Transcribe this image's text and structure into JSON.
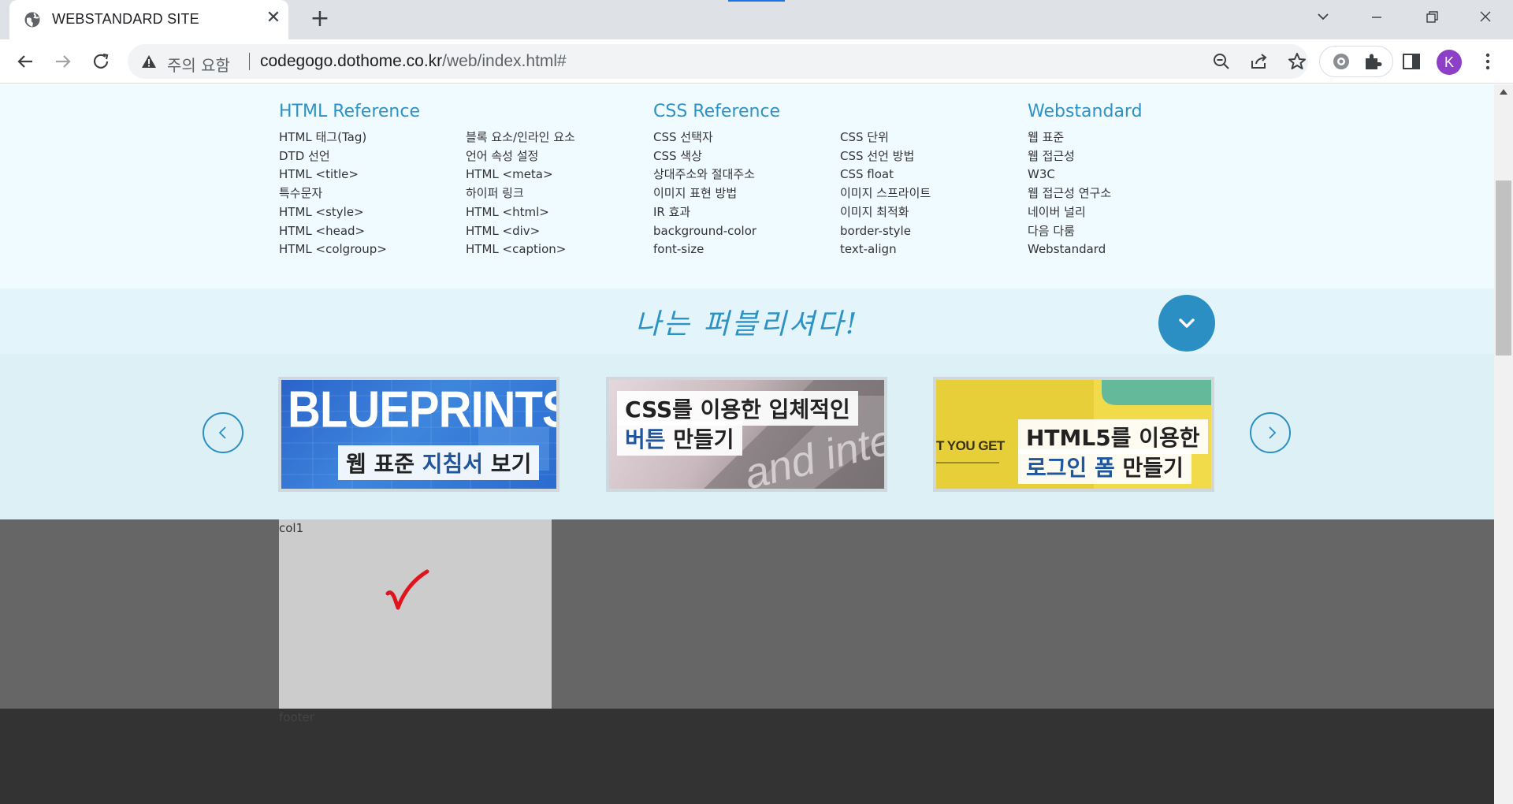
{
  "browser": {
    "tab_title": "WEBSTANDARD SITE",
    "security_label": "주의 요함",
    "url_host": "codegogo.dothome.co.kr",
    "url_path": "/web/index.html#",
    "profile_initial": "K"
  },
  "reference": {
    "columns": [
      {
        "heading": "HTML Reference",
        "items": [
          "HTML 태그(Tag)",
          "DTD 선언",
          "HTML <title>",
          "특수문자",
          "HTML <style>",
          "HTML <head>",
          "HTML <colgroup>"
        ]
      },
      {
        "heading": "",
        "items": [
          "블록 요소/인라인 요소",
          "언어 속성 설정",
          "HTML <meta>",
          "하이퍼 링크",
          "HTML <html>",
          "HTML <div>",
          "HTML <caption>"
        ]
      },
      {
        "heading": "CSS Reference",
        "items": [
          "CSS 선택자",
          "CSS 색상",
          "상대주소와 절대주소",
          "이미지 표현 방법",
          "IR 효과",
          "background-color",
          "font-size"
        ]
      },
      {
        "heading": "",
        "items": [
          "CSS 단위",
          "CSS 선언 방법",
          "CSS float",
          "이미지 스프라이트",
          "이미지 최적화",
          "border-style",
          "text-align"
        ]
      },
      {
        "heading": "Webstandard",
        "items": [
          "웹 표준",
          "웹 접근성",
          "W3C",
          "웹 접근성 연구소",
          "네이버 널리",
          "다음 다룸",
          "Webstandard"
        ]
      }
    ]
  },
  "slogan": "나는 퍼블리셔다!",
  "slider": {
    "slides": [
      {
        "big": "BLUEPRINTS",
        "cap_pre": "웹 표준 ",
        "cap_hl": "지침서",
        "cap_post": " 보기"
      },
      {
        "line1": "CSS를 이용한 입체적인",
        "line2_hl": "버튼",
        "line2_post": " 만들기"
      },
      {
        "side": "T YOU GET",
        "line1": "HTML5를 이용한",
        "line2_hl": "로그인 폼",
        "line2_post": " 만들기"
      }
    ]
  },
  "cols": {
    "col1_label": "col1"
  },
  "footer": {
    "label": "footer"
  },
  "colors": {
    "accent": "#2b8fc4",
    "ref_bg": "#f0fbff",
    "slider_bg": "#dcf0f6",
    "cols_bg": "#666666",
    "col1_bg": "#cccccc",
    "footer_bg": "#333333",
    "check": "#e0141e"
  }
}
